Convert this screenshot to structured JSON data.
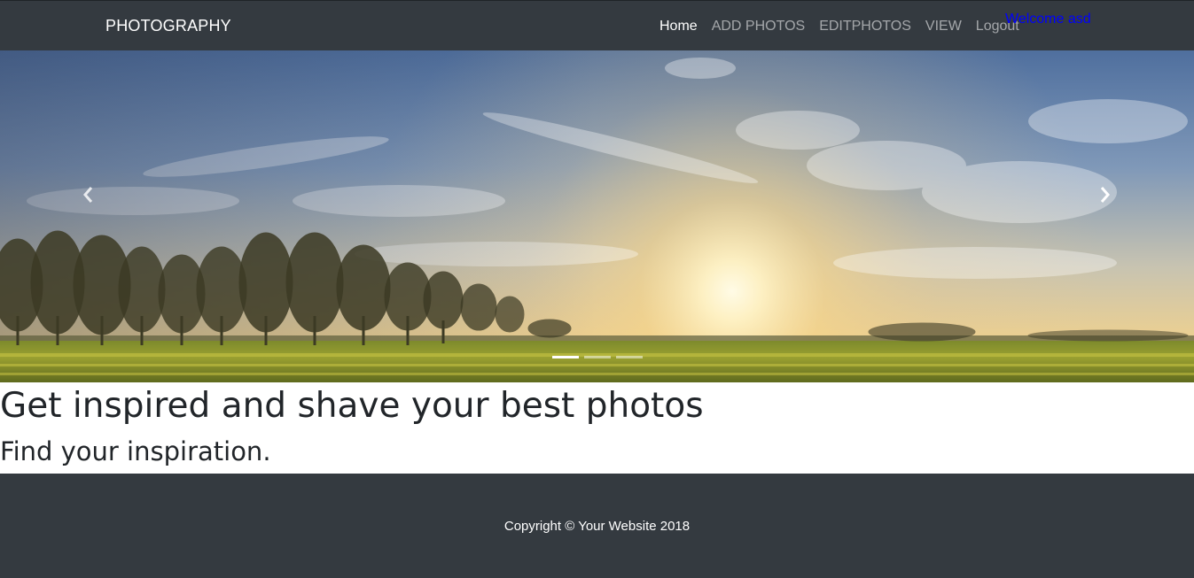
{
  "navbar": {
    "brand": "PHOTOGRAPHY",
    "links": [
      {
        "label": "Home",
        "active": true
      },
      {
        "label": "ADD PHOTOS",
        "active": false
      },
      {
        "label": "EDITPHOTOS",
        "active": false
      },
      {
        "label": "VIEW",
        "active": false
      },
      {
        "label": "Logout",
        "active": false
      }
    ],
    "welcome": "Welcome asd"
  },
  "carousel": {
    "slide_count": 3,
    "active_slide": 1,
    "prev_icon": "chevron-left-icon",
    "next_icon": "chevron-right-icon"
  },
  "content": {
    "headline": "Get inspired and shave your best photos",
    "subline": "Find your inspiration."
  },
  "footer": {
    "copyright": "Copyright © Your Website 2018"
  },
  "colors": {
    "navbar_bg": "#343a40",
    "footer_bg": "#343a40",
    "welcome_text": "#0000ff",
    "nav_link_active": "#ffffff",
    "nav_link_inactive": "rgba(255,255,255,0.55)"
  }
}
